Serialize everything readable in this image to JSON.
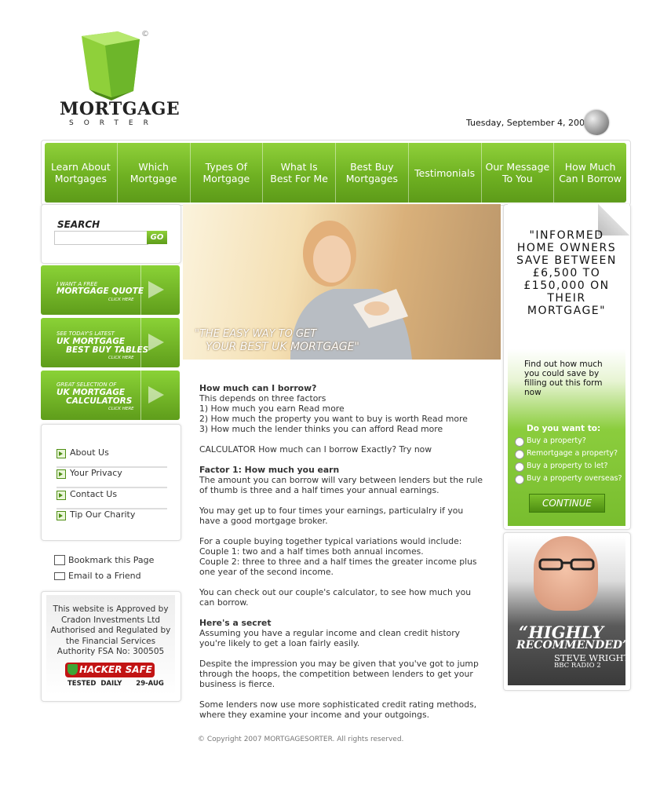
{
  "logo": {
    "name": "MORTGAGE",
    "sub": "SORTER",
    "copyright_mark": "©"
  },
  "date": "Tuesday, September 4, 2007",
  "nav": [
    {
      "line1": "Learn About",
      "line2": "Mortgages"
    },
    {
      "line1": "Which",
      "line2": "Mortgage"
    },
    {
      "line1": "Types Of",
      "line2": "Mortgage"
    },
    {
      "line1": "What Is",
      "line2": "Best For Me"
    },
    {
      "line1": "Best Buy",
      "line2": "Mortgages"
    },
    {
      "line1": "Testimonials",
      "line2": ""
    },
    {
      "line1": "Our Message",
      "line2": "To You"
    },
    {
      "line1": "How Much",
      "line2": "Can I Borrow"
    }
  ],
  "search": {
    "title": "SEARCH",
    "placeholder": "",
    "go": "GO"
  },
  "promos": [
    {
      "small": "I want a free",
      "big1": "Mortgage Quote",
      "big2": "",
      "click": "Click here"
    },
    {
      "small": "See today's latest",
      "big1": "UK Mortgage",
      "big2": "Best Buy Tables",
      "click": "Click here"
    },
    {
      "small": "Great selection of",
      "big1": "UK Mortgage",
      "big2": "Calculators",
      "click": "Click here"
    }
  ],
  "links": [
    "About Us",
    "Your Privacy",
    "Contact Us",
    "Tip Our Charity"
  ],
  "utility": {
    "bookmark": "Bookmark this Page",
    "email": "Email to a Friend"
  },
  "approved": {
    "text": "This website is Approved by Cradon Investments Ltd Authorised and Regulated by the Financial Services Authority FSA No: 300505",
    "hacker_safe": "HACKER SAFE",
    "tested": "TESTED DAILY",
    "tested_date": "29-AUG"
  },
  "hero": {
    "tag1": "\"THE EASY WAY TO GET",
    "tag2": "YOUR BEST UK MORTGAGE\""
  },
  "content": {
    "h1": "How much can I borrow?",
    "p1": [
      "This depends on three factors",
      "1) How much you earn Read more",
      "2) How much the property you want to buy is worth Read more",
      "3) How much the lender thinks you can afford Read more"
    ],
    "calc": "CALCULATOR How much can I borrow Exactly? Try now",
    "h2": "Factor 1: How much you earn",
    "p2": "The amount you can borrow will vary between lenders but the rule of thumb is three and a half times your annual earnings.",
    "p3": "You may get up to four times your earnings, particulalry if you have a good mortgage broker.",
    "p4": [
      "For a couple buying together typical variations would include:",
      "Couple 1: two and a half times both annual incomes.",
      "Couple 2: three to three and a half times the greater income plus one year of the second income."
    ],
    "p5": "You can check out our couple's calculator, to see how much you can borrow.",
    "h3": "Here's a secret",
    "p6": "Assuming you have a regular income and clean credit history you're likely to get a loan fairly easily.",
    "p7": "Despite the impression you may be given that you've got to jump through the hoops, the competition between lenders to get your business is fierce.",
    "p8": "Some lenders now use more sophisticated credit rating methods, where they examine your income and your outgoings."
  },
  "copyright": "© Copyright 2007 MORTGAGESORTER. All rights reserved.",
  "sidebar_right": {
    "quote": "\"Informed home owners save between £6,500 to £150,000 on their mortgage\"",
    "find_out": "Find out how much you could save by filling out this form now",
    "do_you_want": "Do you want to:",
    "options": [
      "Buy a property?",
      "Remortgage a property?",
      "Buy a property to let?",
      "Buy a property overseas?"
    ],
    "continue": "CONTINUE"
  },
  "testimonial": {
    "highly": "“HIGHLY",
    "recommended": "RECOMMENDED”",
    "name": "STEVE WRIGHT",
    "source": "BBC RADIO 2"
  }
}
